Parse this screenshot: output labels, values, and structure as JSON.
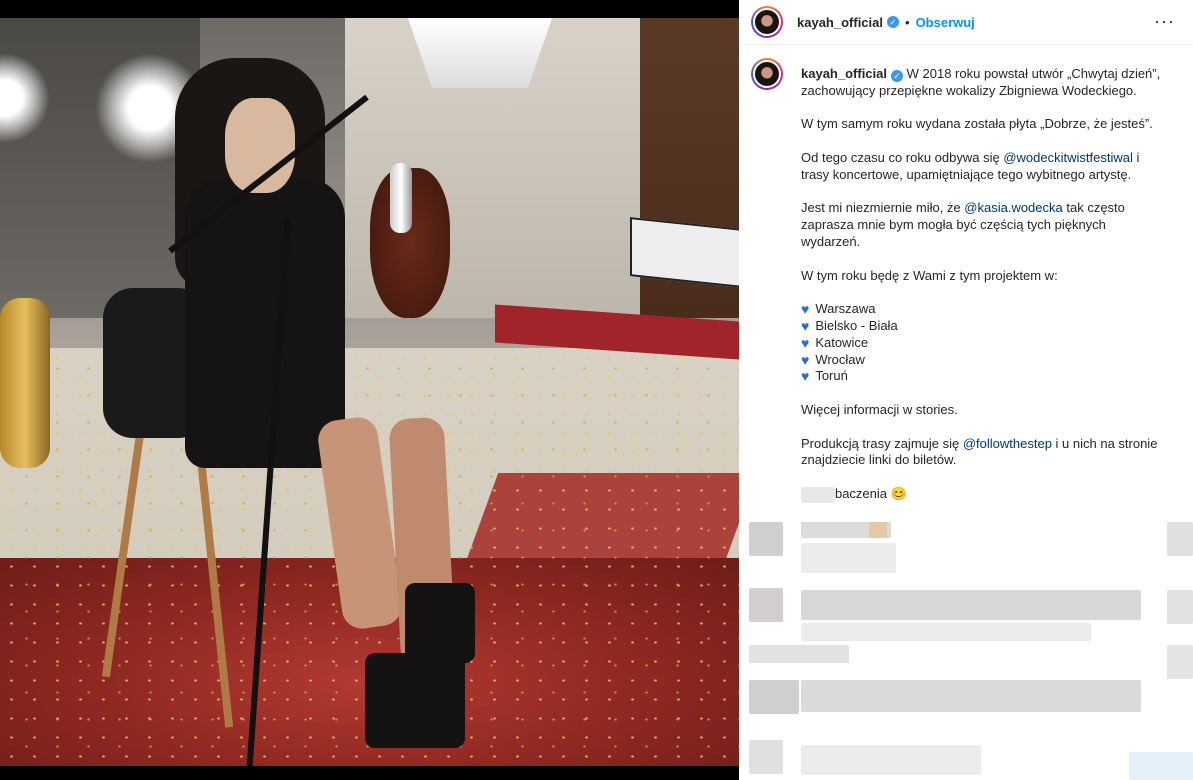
{
  "post": {
    "username": "kayah_official",
    "follow_label": "Obserwuj",
    "dot": "•",
    "more_label": "···",
    "verified_mark": "✓",
    "caption": {
      "intro": "W 2018 roku powstał utwór „Chwytaj dzień”, zachowujący przepiękne wokalizy Zbigniewa Wodeckiego.",
      "p2": "W tym samym roku wydana została płyta „Dobrze, że jesteś”.",
      "p3_before": "Od tego czasu co roku odbywa się ",
      "p3_mention": "@wodeckitwistfestiwal",
      "p3_after": " i trasy koncertowe, upamiętniające tego wybitnego artystę.",
      "p4_before": "Jest mi niezmiernie miło, że ",
      "p4_mention": "@kasia.wodecka",
      "p4_after": " tak często zaprasza mnie bym mogła być częścią tych pięknych wydarzeń.",
      "p5": "W tym roku będę z Wami z tym projektem w:",
      "cities": [
        "Warszawa",
        "Bielsko - Biała",
        "Katowice",
        "Wrocław",
        "Toruń"
      ],
      "heart": "♥",
      "p6": "Więcej informacji w stories.",
      "p7_before": "Produkcją trasy zajmuje się ",
      "p7_mention": "@followthestep",
      "p7_after": " i u nich na stronie znajdziecie linki do biletów.",
      "p8": "Do zobaczenia",
      "p8_emoji": "😊"
    }
  },
  "colors": {
    "link": "#00376b",
    "follow": "#0095f6",
    "verified": "#3897f0",
    "heart": "#2672c9"
  },
  "icons": [
    "verified-badge-icon",
    "more-options-icon",
    "blue-heart-icon"
  ]
}
